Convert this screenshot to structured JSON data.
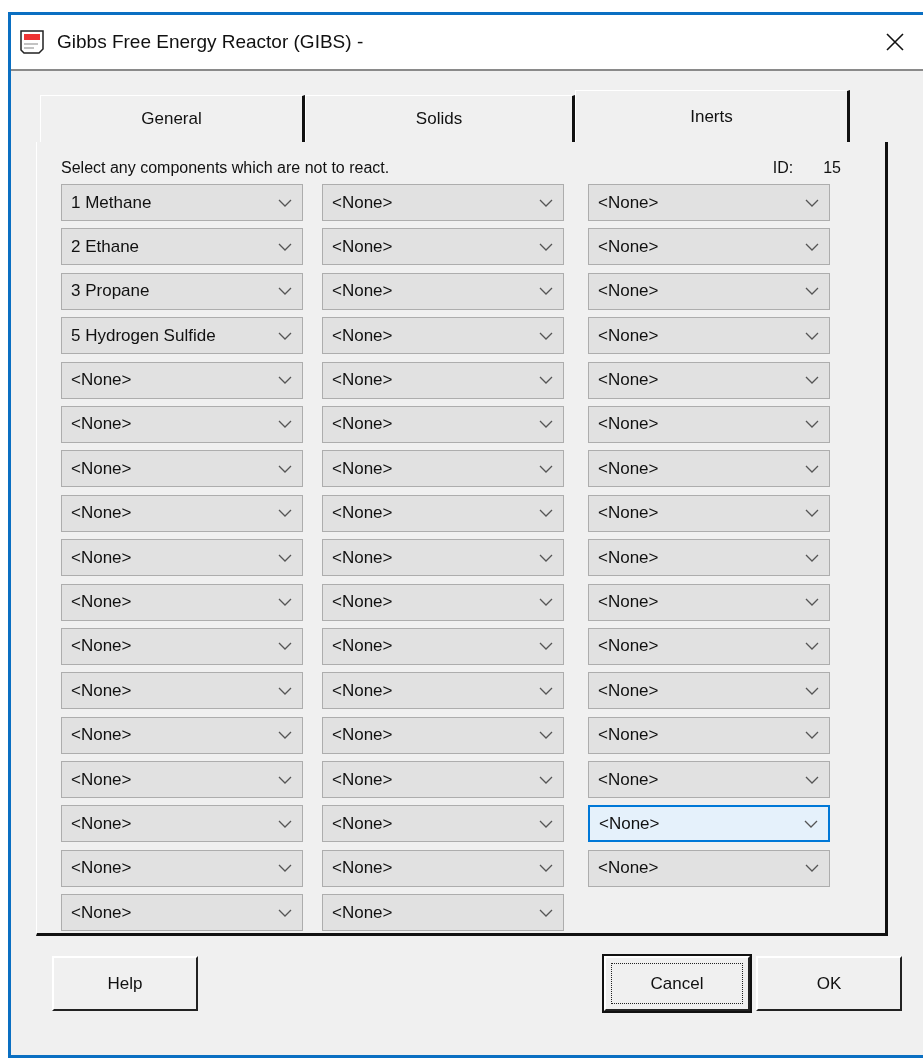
{
  "window": {
    "title": "Gibbs Free Energy Reactor (GIBS) -"
  },
  "tabs": [
    {
      "label": "General",
      "selected": false
    },
    {
      "label": "Solids",
      "selected": false
    },
    {
      "label": "Inerts",
      "selected": true
    }
  ],
  "panel": {
    "instruction": "Select any components which are not to react.",
    "id_label": "ID:",
    "id_value": "15",
    "columns": [
      [
        {
          "value": "1 Methane",
          "focused": false
        },
        {
          "value": "2 Ethane",
          "focused": false
        },
        {
          "value": "3 Propane",
          "focused": false
        },
        {
          "value": "5 Hydrogen Sulfide",
          "focused": false
        },
        {
          "value": "<None>",
          "focused": false
        },
        {
          "value": "<None>",
          "focused": false
        },
        {
          "value": "<None>",
          "focused": false
        },
        {
          "value": "<None>",
          "focused": false
        },
        {
          "value": "<None>",
          "focused": false
        },
        {
          "value": "<None>",
          "focused": false
        },
        {
          "value": "<None>",
          "focused": false
        },
        {
          "value": "<None>",
          "focused": false
        },
        {
          "value": "<None>",
          "focused": false
        },
        {
          "value": "<None>",
          "focused": false
        },
        {
          "value": "<None>",
          "focused": false
        },
        {
          "value": "<None>",
          "focused": false
        },
        {
          "value": "<None>",
          "focused": false
        }
      ],
      [
        {
          "value": "<None>",
          "focused": false
        },
        {
          "value": "<None>",
          "focused": false
        },
        {
          "value": "<None>",
          "focused": false
        },
        {
          "value": "<None>",
          "focused": false
        },
        {
          "value": "<None>",
          "focused": false
        },
        {
          "value": "<None>",
          "focused": false
        },
        {
          "value": "<None>",
          "focused": false
        },
        {
          "value": "<None>",
          "focused": false
        },
        {
          "value": "<None>",
          "focused": false
        },
        {
          "value": "<None>",
          "focused": false
        },
        {
          "value": "<None>",
          "focused": false
        },
        {
          "value": "<None>",
          "focused": false
        },
        {
          "value": "<None>",
          "focused": false
        },
        {
          "value": "<None>",
          "focused": false
        },
        {
          "value": "<None>",
          "focused": false
        },
        {
          "value": "<None>",
          "focused": false
        },
        {
          "value": "<None>",
          "focused": false
        }
      ],
      [
        {
          "value": "<None>",
          "focused": false
        },
        {
          "value": "<None>",
          "focused": false
        },
        {
          "value": "<None>",
          "focused": false
        },
        {
          "value": "<None>",
          "focused": false
        },
        {
          "value": "<None>",
          "focused": false
        },
        {
          "value": "<None>",
          "focused": false
        },
        {
          "value": "<None>",
          "focused": false
        },
        {
          "value": "<None>",
          "focused": false
        },
        {
          "value": "<None>",
          "focused": false
        },
        {
          "value": "<None>",
          "focused": false
        },
        {
          "value": "<None>",
          "focused": false
        },
        {
          "value": "<None>",
          "focused": false
        },
        {
          "value": "<None>",
          "focused": false
        },
        {
          "value": "<None>",
          "focused": false
        },
        {
          "value": "<None>",
          "focused": true
        },
        {
          "value": "<None>",
          "focused": false
        }
      ]
    ]
  },
  "buttons": [
    {
      "label": "Help",
      "default": false
    },
    {
      "label": "Cancel",
      "default": true
    },
    {
      "label": "OK",
      "default": false
    }
  ]
}
